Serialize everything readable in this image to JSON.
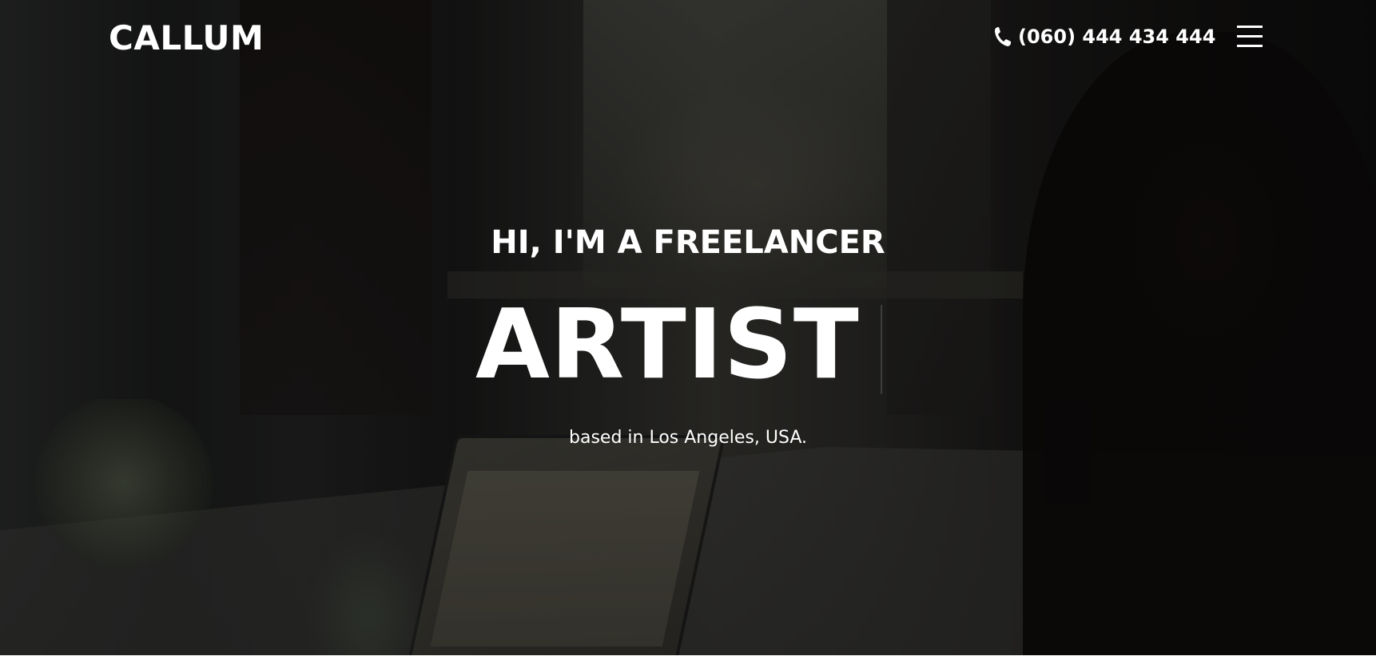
{
  "header": {
    "logo": "CALLUM",
    "phone": "(060) 444 434 444",
    "phone_icon": "phone-icon",
    "menu_icon": "hamburger-menu-icon"
  },
  "hero": {
    "subtitle": "HI, I'M A FREELANCER",
    "role": "ARTIST",
    "location": "based in Los Angeles, USA.",
    "overlay_color": "#000000",
    "text_color": "#ffffff"
  }
}
